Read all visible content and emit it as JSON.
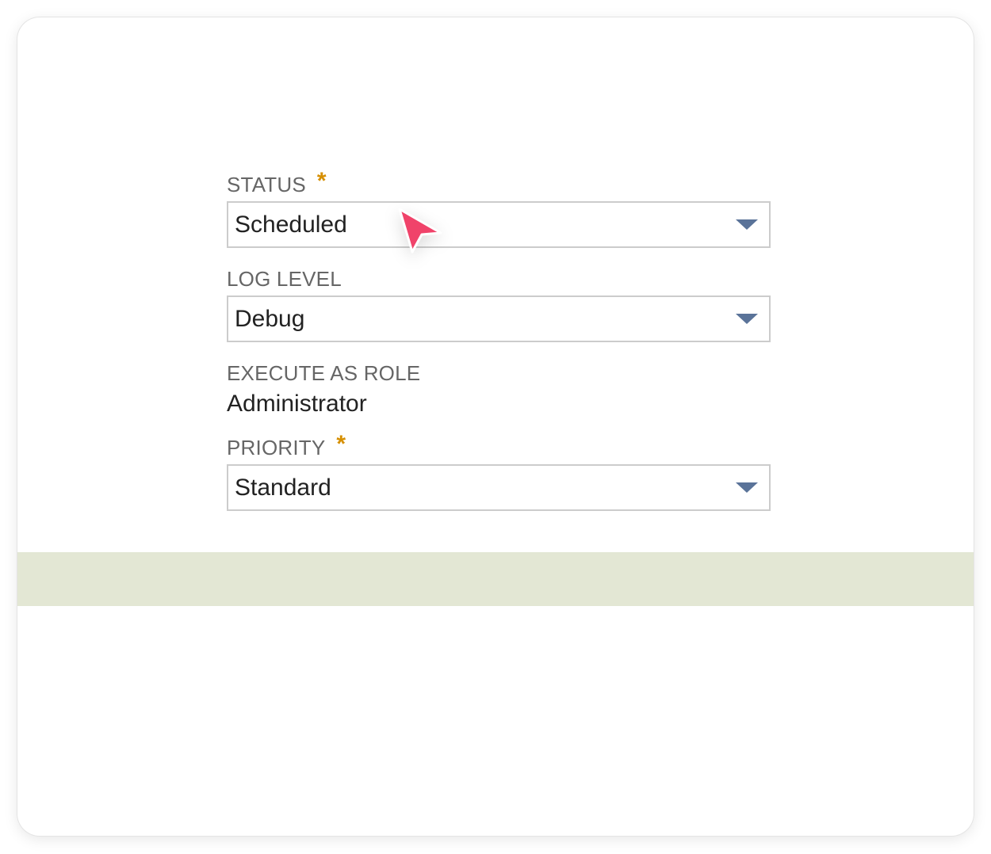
{
  "form": {
    "status": {
      "label": "STATUS",
      "required_mark": "*",
      "value": "Scheduled"
    },
    "log_level": {
      "label": "LOG LEVEL",
      "value": "Debug"
    },
    "execute_as_role": {
      "label": "EXECUTE AS ROLE",
      "value": "Administrator"
    },
    "priority": {
      "label": "PRIORITY",
      "required_mark": "*",
      "value": "Standard"
    }
  },
  "colors": {
    "required": "#d68f00",
    "caret": "#5a7399",
    "footer_band": "#e3e7d4",
    "cursor": "#f0436a"
  },
  "icons": {
    "dropdown": "caret-down-icon",
    "pointer": "mouse-cursor-icon"
  }
}
